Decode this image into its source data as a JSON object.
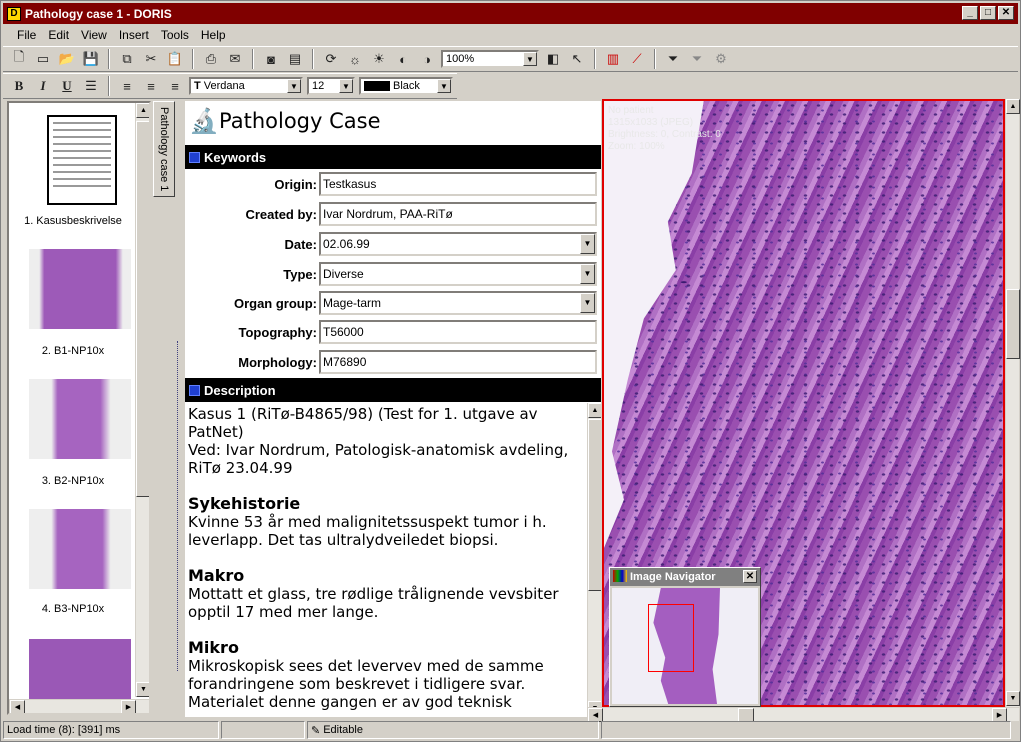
{
  "window": {
    "title": "Pathology case 1 - DORIS",
    "controls": [
      "_",
      "□",
      "✕"
    ]
  },
  "menu": [
    "File",
    "Edit",
    "View",
    "Insert",
    "Tools",
    "Help"
  ],
  "toolbar": {
    "zoom": "100%"
  },
  "format": {
    "bold": "B",
    "italic": "I",
    "underline": "U",
    "font": "Verdana",
    "size": "12",
    "color": "Black",
    "color_hex": "#000000"
  },
  "sidebar": {
    "tab_label": "Pathology case 1",
    "items": [
      {
        "label": "1. Kasusbeskrivelse",
        "kind": "document"
      },
      {
        "label": "2. B1-NP10x",
        "kind": "image"
      },
      {
        "label": "3. B2-NP10x",
        "kind": "image"
      },
      {
        "label": "4. B3-NP10x",
        "kind": "image"
      },
      {
        "label": "",
        "kind": "image"
      }
    ]
  },
  "form": {
    "title": "Pathology Case",
    "keywords_header": "Keywords",
    "description_header": "Description",
    "fields": [
      {
        "label": "Origin:",
        "value": "Testkasus",
        "dropdown": false
      },
      {
        "label": "Created by:",
        "value": "Ivar Nordrum, PAA-RiTø",
        "dropdown": false
      },
      {
        "label": "Date:",
        "value": "02.06.99",
        "dropdown": true
      },
      {
        "label": "Type:",
        "value": "Diverse",
        "dropdown": true
      },
      {
        "label": "Organ group:",
        "value": "Mage-tarm",
        "dropdown": true
      },
      {
        "label": "Topography:",
        "value": "T56000",
        "dropdown": false
      },
      {
        "label": "Morphology:",
        "value": "M76890",
        "dropdown": false
      }
    ]
  },
  "description": {
    "intro": "Kasus 1 (RiTø-B4865/98) (Test for 1. utgave av PatNet)",
    "intro2": "Ved: Ivar Nordrum, Patologisk-anatomisk avdeling, RiTø 23.04.99",
    "h1": "Sykehistorie",
    "p1": "Kvinne 53 år med malignitetssuspekt tumor i h. leverlapp. Det tas ultralydveiledet biopsi.",
    "h2": "Makro",
    "p2": "Mottatt et glass, tre rødlige trålignende vevsbiter opptil 17 med mer lange.",
    "h3": "Mikro",
    "p3": "Mikroskopisk sees det levervev med de samme forandringene som beskrevet i tidligere svar. Materialet denne gangen er av god teknisk"
  },
  "image": {
    "info": [
      "No patient",
      "1315x1033 (JPEG)",
      "Brightness: 0, Contrast: 0",
      "Zoom: 100%"
    ]
  },
  "navigator": {
    "title": "Image Navigator"
  },
  "status": {
    "load": "Load time (8): [391] ms",
    "mode": "Editable"
  }
}
